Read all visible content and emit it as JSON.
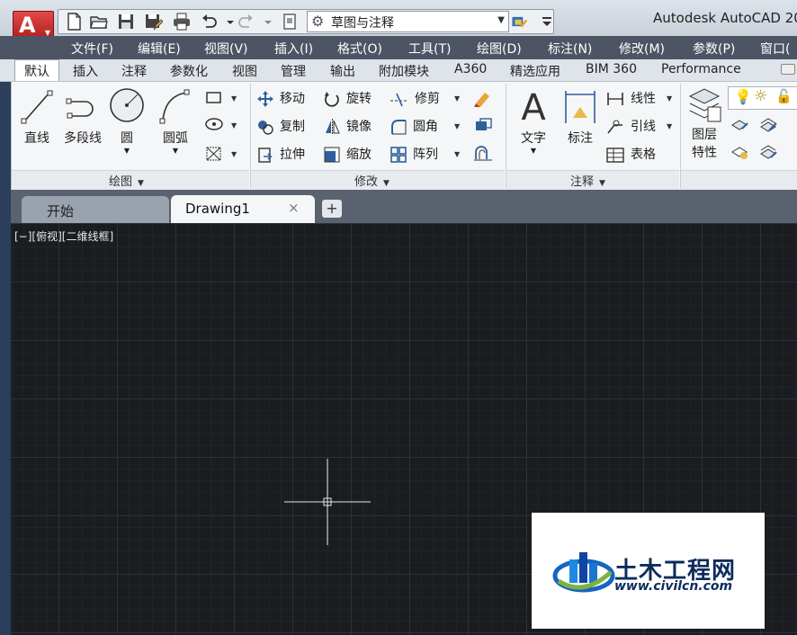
{
  "title_bar": {
    "app_title": "Autodesk AutoCAD 20",
    "logo_letter": "A"
  },
  "quick_access": {
    "workspace": "草图与注释"
  },
  "menu": [
    "文件(F)",
    "编辑(E)",
    "视图(V)",
    "插入(I)",
    "格式(O)",
    "工具(T)",
    "绘图(D)",
    "标注(N)",
    "修改(M)",
    "参数(P)",
    "窗口("
  ],
  "ribbon_tabs": [
    "默认",
    "插入",
    "注释",
    "参数化",
    "视图",
    "管理",
    "输出",
    "附加模块",
    "A360",
    "精选应用",
    "BIM 360",
    "Performance"
  ],
  "panels": {
    "draw": {
      "title": "绘图",
      "line": "直线",
      "polyline": "多段线",
      "circle": "圆",
      "arc": "圆弧"
    },
    "modify": {
      "title": "修改",
      "move": "移动",
      "rotate": "旋转",
      "trim": "修剪",
      "copy": "复制",
      "mirror": "镜像",
      "fillet": "圆角",
      "stretch": "拉伸",
      "scale": "缩放",
      "array": "阵列"
    },
    "annotation": {
      "title": "注释",
      "text": "文字",
      "dimension": "标注",
      "linear": "线性",
      "leader": "引线",
      "table": "表格"
    },
    "layers": {
      "layer_props_line1": "图层",
      "layer_props_line2": "特性"
    }
  },
  "file_tabs": {
    "start": "开始",
    "drawing": "Drawing1",
    "close_glyph": "×",
    "new_glyph": "+"
  },
  "viewport": {
    "controls": "[−][俯视][二维线框]"
  },
  "watermark": {
    "cn": "土木工程网",
    "url": "www.civilcn.com"
  },
  "colors": {
    "canvas": "#1a1c20",
    "menu_bar": "#4d5564",
    "logo_red": "#c62828",
    "ribbon": "#f4f6f8"
  }
}
